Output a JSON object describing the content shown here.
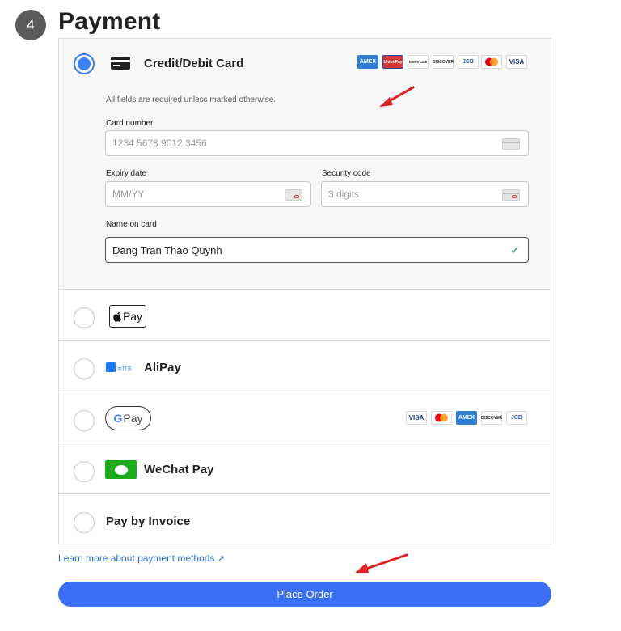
{
  "step": {
    "number": "4",
    "title": "Payment"
  },
  "credit_card": {
    "label": "Credit/Debit Card",
    "note": "All fields are required unless marked otherwise.",
    "card_number": {
      "label": "Card number",
      "placeholder": "1234 5678 9012 3456",
      "value": ""
    },
    "expiry": {
      "label": "Expiry date",
      "placeholder": "MM/YY",
      "value": ""
    },
    "security": {
      "label": "Security code",
      "placeholder": "3 digits",
      "value": ""
    },
    "name": {
      "label": "Name on card",
      "value": "Dang Tran Thao Quynh"
    },
    "brands": [
      "AMEX",
      "UnionPay",
      "Diners Club",
      "DISCOVER",
      "JCB",
      "Mastercard",
      "VISA"
    ]
  },
  "methods": {
    "apple_pay": {
      "logo_text": "Pay"
    },
    "alipay": {
      "label": "AliPay",
      "logo_text": "支付宝"
    },
    "google_pay": {
      "logo_g": "G",
      "logo_text": "Pay",
      "brands": [
        "VISA",
        "Mastercard",
        "AMEX",
        "DISCOVER",
        "JCB"
      ]
    },
    "wechat_pay": {
      "label": "WeChat Pay"
    },
    "invoice": {
      "label": "Pay by Invoice"
    }
  },
  "selected_method": "credit_card",
  "learn_more": {
    "label": "Learn more about payment methods"
  },
  "place_order": {
    "label": "Place Order"
  },
  "colors": {
    "accent": "#3b82f6",
    "button": "#3b6ff5",
    "link": "#2b6cd8",
    "valid": "#1f9d55",
    "arrow": "#e02020"
  }
}
